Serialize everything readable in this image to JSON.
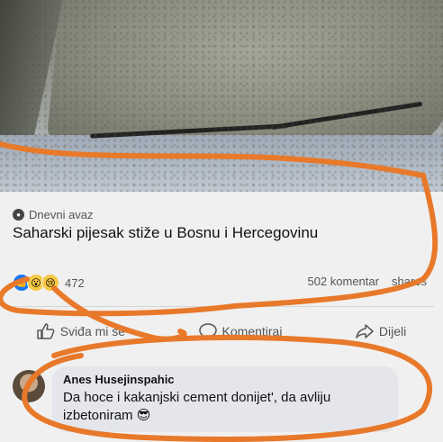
{
  "post": {
    "source": "Dnevni avaz",
    "source_icon": "globe-icon",
    "headline": "Saharski pijesak stiže u Bosnu i Hercegovinu"
  },
  "stats": {
    "reaction_icons": [
      "like-icon",
      "wow-icon",
      "sad-icon"
    ],
    "reactions_count": "472",
    "comments": "502 komentar",
    "shares": "shares"
  },
  "actions": {
    "like": "Sviđa mi se",
    "comment": "Komentiraj",
    "share": "Dijeli"
  },
  "comment": {
    "author": "Anes Husejinspahic",
    "text": "Da hoce i kakanjski cement donijet', da avliju izbetoniram",
    "emoji": "😎"
  },
  "colors": {
    "annotation": "#e8792a",
    "like_blue": "#1877f2",
    "bubble": "#e4e6eb"
  }
}
